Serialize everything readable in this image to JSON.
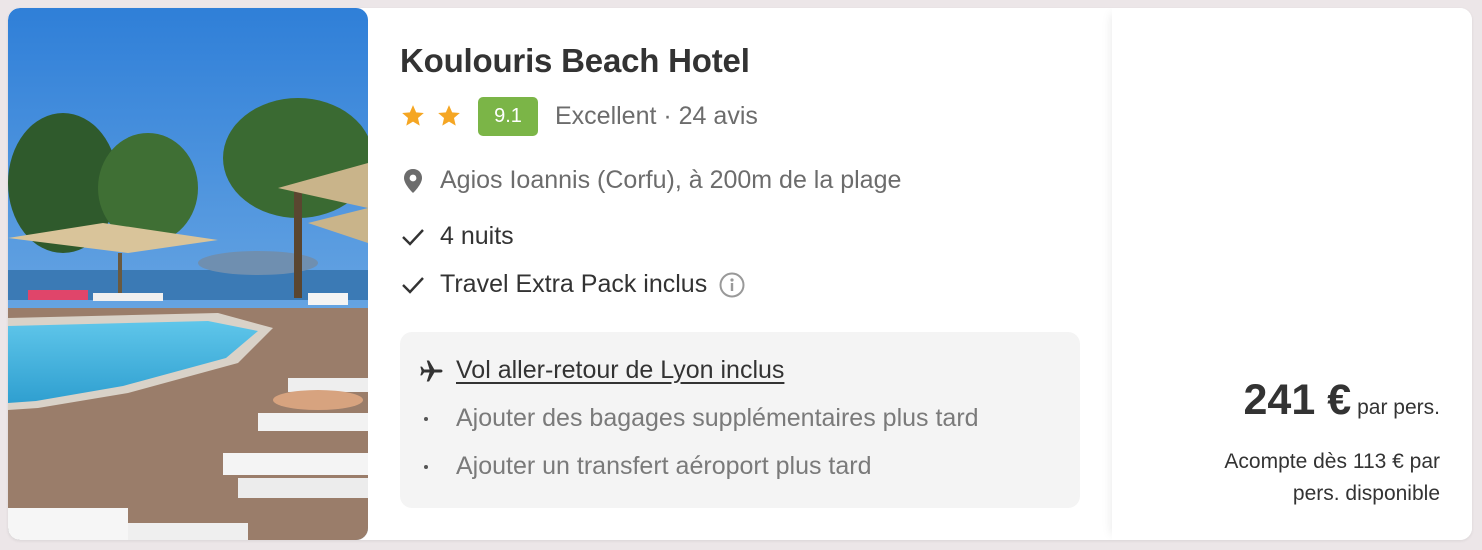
{
  "hotel": {
    "name": "Koulouris Beach Hotel",
    "stars": 2,
    "score": "9.1",
    "review_text": "Excellent · 24 avis",
    "location": "Agios Ioannis (Corfu), à 200m de la plage",
    "nights": "4 nuits",
    "pack": "Travel Extra Pack inclus"
  },
  "flight": {
    "title": "Vol aller-retour de Lyon inclus",
    "options": [
      "Ajouter des bagages supplémentaires plus tard",
      "Ajouter un transfert aéroport plus tard"
    ]
  },
  "pricing": {
    "amount": "241 €",
    "per": "par pers.",
    "deposit": "Acompte dès 113 € par pers. disponible"
  },
  "colors": {
    "star": "#f5a623",
    "score_badge": "#7bb547",
    "background": "#ece6e8"
  },
  "icons": [
    "star-icon",
    "map-pin-icon",
    "checkmark-icon",
    "info-icon",
    "airplane-icon"
  ]
}
